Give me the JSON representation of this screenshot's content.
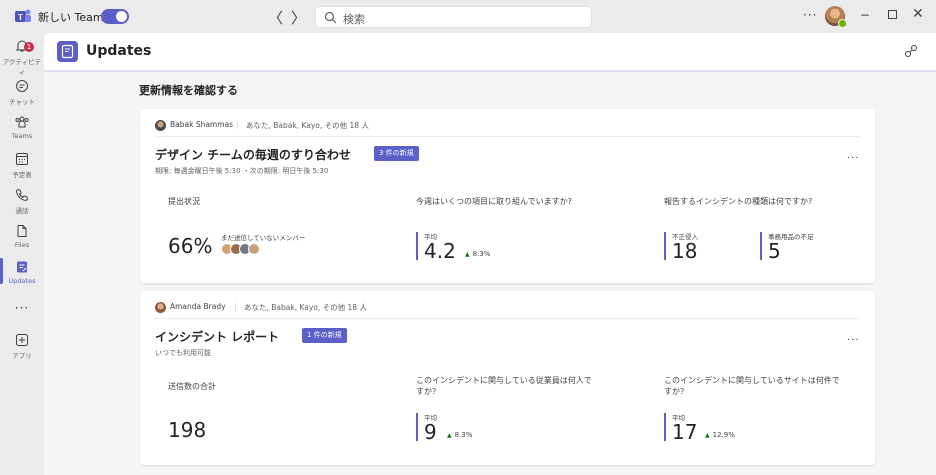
{
  "titlebar": {
    "app_name": "新しい Teams",
    "search_placeholder": "検索",
    "more": "···",
    "nav_back": "〈",
    "nav_forward": "〉",
    "minimize": "−",
    "close": "✕"
  },
  "rail": {
    "items": [
      {
        "label": "アクティビティ",
        "icon": "bell-icon",
        "badge": "1"
      },
      {
        "label": "チャット",
        "icon": "chat-icon"
      },
      {
        "label": "Teams",
        "icon": "teams-icon"
      },
      {
        "label": "予定表",
        "icon": "calendar-icon"
      },
      {
        "label": "通話",
        "icon": "phone-icon"
      },
      {
        "label": "Files",
        "icon": "file-icon"
      },
      {
        "label": "Updates",
        "icon": "updates-icon",
        "active": true
      },
      {
        "label": "アプリ",
        "icon": "add-app-icon"
      }
    ],
    "more": "···"
  },
  "header": {
    "title": "Updates"
  },
  "section_title": "更新情報を確認する",
  "cards": [
    {
      "author": "Babak Shammas",
      "recipients": "あなた, Babak, Kayo, その他 18 人",
      "title": "デザイン チームの毎週のすり合わせ",
      "new_badge": "3 件の新規",
      "subtitle": "期限: 毎週金曜日午後 5:30 ・次の期限: 明日午後 5:30",
      "more": "···",
      "metrics": [
        {
          "label": "提出状況",
          "value": "66%",
          "pending_label": "まだ送信していないメンバー"
        },
        {
          "label": "今週はいくつの項目に取り組んでいますか?",
          "caption": "平均",
          "value": "4.2",
          "trend": "8.3%"
        },
        {
          "label": "報告するインシデントの種類は何ですか?",
          "items": [
            {
              "caption": "不正侵入",
              "value": "18"
            },
            {
              "caption": "事務用品の不足",
              "value": "5"
            }
          ]
        }
      ]
    },
    {
      "author": "Amanda Brady",
      "recipients": "あなた, Babak, Kayo, その他 18 人",
      "title": "インシデント レポート",
      "new_badge": "1 件の新規",
      "subtitle": "いつでも利用可能",
      "more": "···",
      "metrics": [
        {
          "label": "送信数の合計",
          "value": "198"
        },
        {
          "label": "このインシデントに関与している従業員は何人ですか?",
          "caption": "平均",
          "value": "9",
          "trend": "8.3%"
        },
        {
          "label": "このインシデントに関与しているサイトは何件ですか?",
          "caption": "平均",
          "value": "17",
          "trend": "12.9%"
        }
      ]
    }
  ],
  "colors": {
    "accent": "#5b5fc7",
    "trend_up": "#107c10",
    "badge": "#c4314b"
  }
}
